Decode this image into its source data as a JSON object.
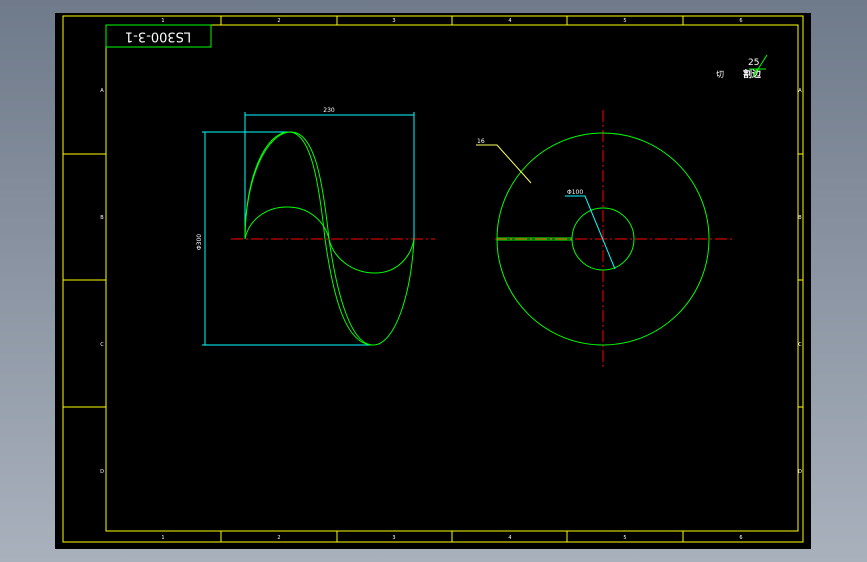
{
  "drawing": {
    "title_block_code": "LS300-3-1",
    "column_markers": [
      "1",
      "2",
      "3",
      "4",
      "5",
      "6"
    ],
    "row_markers": [
      "A",
      "B",
      "C",
      "D"
    ],
    "note": {
      "label_cut": "切",
      "label_weld": "割边",
      "roughness_value": "25"
    }
  },
  "views": {
    "side_view": {
      "pitch_dimension": "230",
      "diameter_dimension": "Φ300"
    },
    "end_view": {
      "leader_thickness": "16",
      "inner_diameter": "Φ100"
    }
  },
  "colors": {
    "background": "#000000",
    "frame": "#ffff00",
    "geometry": "#00ff00",
    "dimensions": "#00ffff",
    "centerline": "#ff0000",
    "leader": "#ffff66",
    "text": "#ffffff"
  }
}
